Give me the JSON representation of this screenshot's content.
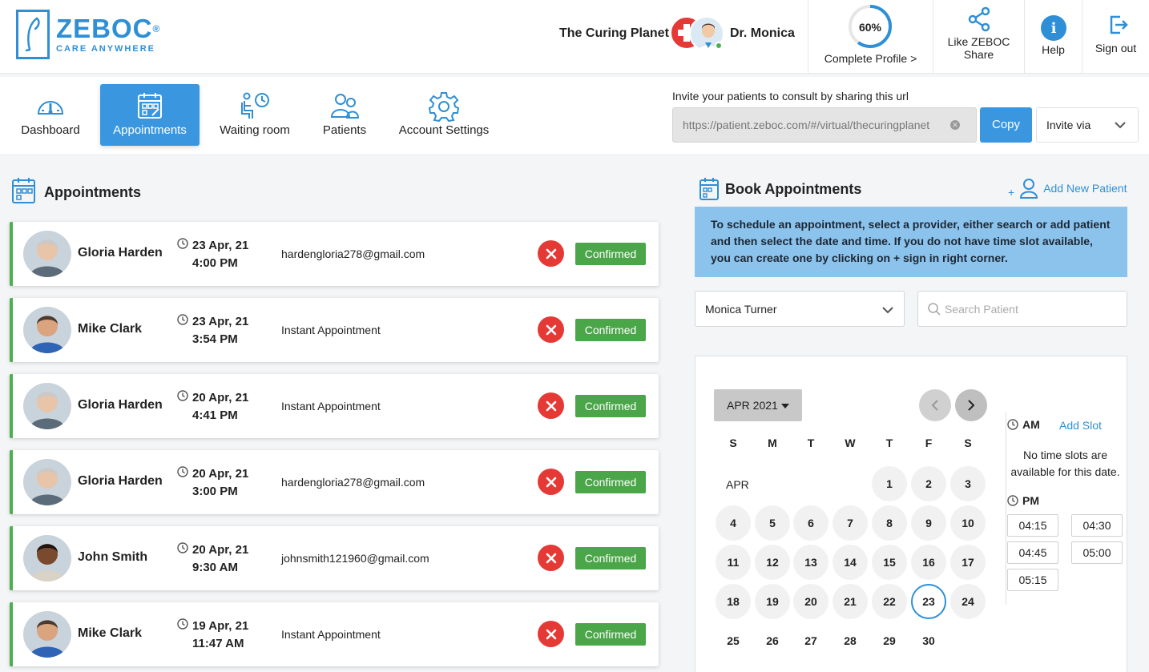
{
  "brand": {
    "name": "ZEBOC",
    "registered": "®",
    "tagline": "CARE ANYWHERE"
  },
  "header": {
    "clinic_name": "The Curing Planet",
    "doctor_name": "Dr. Monica",
    "profile_percent": "60%",
    "profile_fraction": 0.6,
    "profile_label": "Complete Profile >",
    "share_label_1": "Like ZEBOC",
    "share_label_2": "Share",
    "help_label": "Help",
    "help_icon": "i",
    "signout_label": "Sign out"
  },
  "nav": {
    "items": [
      {
        "label": "Dashboard",
        "icon": "speedometer-icon"
      },
      {
        "label": "Appointments",
        "icon": "calendar-icon",
        "active": true
      },
      {
        "label": "Waiting room",
        "icon": "waiting-room-icon"
      },
      {
        "label": "Patients",
        "icon": "users-icon"
      },
      {
        "label": "Account Settings",
        "icon": "gear-icon"
      }
    ]
  },
  "invite": {
    "label": "Invite your patients to consult by sharing this url",
    "url": "https://patient.zeboc.com/#/virtual/thecuringplanet",
    "copy_label": "Copy",
    "invite_via_label": "Invite via"
  },
  "appointments": {
    "title": "Appointments",
    "list": [
      {
        "name": "Gloria Harden",
        "date": "23 Apr, 21",
        "time": "4:00 PM",
        "detail": "hardengloria278@gmail.com",
        "status": "Confirmed"
      },
      {
        "name": "Mike Clark",
        "date": "23 Apr, 21",
        "time": "3:54 PM",
        "detail": "Instant Appointment",
        "status": "Confirmed"
      },
      {
        "name": "Gloria Harden",
        "date": "20 Apr, 21",
        "time": "4:41 PM",
        "detail": "Instant Appointment",
        "status": "Confirmed"
      },
      {
        "name": "Gloria Harden",
        "date": "20 Apr, 21",
        "time": "3:00 PM",
        "detail": "hardengloria278@gmail.com",
        "status": "Confirmed"
      },
      {
        "name": "John Smith",
        "date": "20 Apr, 21",
        "time": "9:30 AM",
        "detail": "johnsmith121960@gmail.com",
        "status": "Confirmed"
      },
      {
        "name": "Mike Clark",
        "date": "19 Apr, 21",
        "time": "11:47 AM",
        "detail": "Instant Appointment",
        "status": "Confirmed"
      }
    ]
  },
  "booking": {
    "title": "Book Appointments",
    "add_patient_plus": "+",
    "add_patient_label": "Add New Patient",
    "info_text": "To schedule an appointment, select a provider, either search or add patient and then select the date and time. If you do not have time slot available, you can create one by clicking on + sign in right corner.",
    "provider": "Monica Turner",
    "search_placeholder": "Search Patient",
    "calendar": {
      "month_label": "APR 2021",
      "row_label": "APR",
      "weekdays": [
        "S",
        "M",
        "T",
        "W",
        "T",
        "F",
        "S"
      ],
      "selected_day": "23",
      "weeks": [
        [
          "",
          "",
          "",
          "",
          "1",
          "2",
          "3"
        ],
        [
          "4",
          "5",
          "6",
          "7",
          "8",
          "9",
          "10"
        ],
        [
          "11",
          "12",
          "13",
          "14",
          "15",
          "16",
          "17"
        ],
        [
          "18",
          "19",
          "20",
          "21",
          "22",
          "23",
          "24"
        ],
        [
          "25",
          "26",
          "27",
          "28",
          "29",
          "30",
          ""
        ]
      ]
    },
    "slots": {
      "am_label": "AM",
      "add_slot_label": "Add Slot",
      "no_slots_text": "No time slots are available for this date.",
      "pm_label": "PM",
      "pm_slots": [
        "04:15",
        "04:30",
        "04:45",
        "05:00",
        "05:15"
      ]
    }
  },
  "colors": {
    "brand_blue": "#2e8fd6",
    "active_tab": "#3a97df",
    "confirmed_green": "#4aa648",
    "cancel_red": "#e53935",
    "info_bg": "#8cc3ec"
  }
}
